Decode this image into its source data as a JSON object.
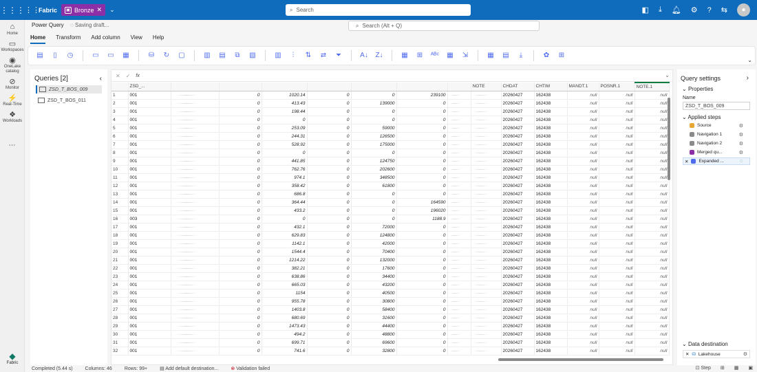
{
  "topbar": {
    "app_name": "Fabric",
    "workspace": "Bronze",
    "search_placeholder": "Search"
  },
  "rail": [
    {
      "label": "Home",
      "icon": "home-icon"
    },
    {
      "label": "Workspaces",
      "icon": "workspaces-icon"
    },
    {
      "label": "OneLake catalog",
      "icon": "onelake-icon"
    },
    {
      "label": "Monitor",
      "icon": "monitor-icon"
    },
    {
      "label": "Real-Time",
      "icon": "realtime-icon"
    },
    {
      "label": "Workloads",
      "icon": "workloads-icon"
    }
  ],
  "rail_fabric_label": "Fabric",
  "editor": {
    "title": "Power Query",
    "saving": "Saving draft...",
    "command_search": "Search (Alt + Q)"
  },
  "tabs": [
    "Home",
    "Transform",
    "Add column",
    "View",
    "Help"
  ],
  "queries": {
    "heading": "Queries [2]",
    "items": [
      "ZSD_T_BOS_009",
      "ZSD_T_BOS_011"
    ]
  },
  "grid": {
    "columns": [
      "",
      "ZSD_...",
      "",
      "",
      "",
      "",
      "",
      "",
      "",
      "NOTE",
      "CHDAT",
      "CHTIM",
      "MANDT.1",
      "POSNR.1",
      "NOTE.1"
    ],
    "rows": [
      [
        "1",
        "001",
        "",
        "0",
        "1020.14",
        "0",
        "0",
        "239100",
        "",
        "",
        "20260427",
        "162438",
        "null",
        "null",
        "null"
      ],
      [
        "2",
        "001",
        "",
        "0",
        "413.43",
        "0",
        "139000",
        "0",
        "",
        "",
        "20260427",
        "162438",
        "null",
        "null",
        "null"
      ],
      [
        "3",
        "001",
        "",
        "0",
        "198.44",
        "0",
        "0",
        "0",
        "",
        "",
        "20260427",
        "162438",
        "null",
        "null",
        "null"
      ],
      [
        "4",
        "001",
        "",
        "0",
        "0",
        "0",
        "0",
        "0",
        "",
        "",
        "20260427",
        "162438",
        "null",
        "null",
        "null"
      ],
      [
        "5",
        "001",
        "",
        "0",
        "253.09",
        "0",
        "59000",
        "0",
        "",
        "",
        "20260427",
        "162438",
        "null",
        "null",
        "null"
      ],
      [
        "6",
        "001",
        "",
        "0",
        "244.31",
        "0",
        "126500",
        "0",
        "",
        "",
        "20260427",
        "162438",
        "null",
        "null",
        "null"
      ],
      [
        "7",
        "001",
        "",
        "0",
        "528.92",
        "0",
        "175000",
        "0",
        "",
        "",
        "20260427",
        "162438",
        "null",
        "null",
        "null"
      ],
      [
        "8",
        "001",
        "",
        "0",
        "0",
        "0",
        "0",
        "0",
        "",
        "",
        "20260427",
        "162438",
        "null",
        "null",
        "null"
      ],
      [
        "9",
        "001",
        "",
        "0",
        "441.85",
        "0",
        "124750",
        "0",
        "",
        "",
        "20260427",
        "162438",
        "null",
        "null",
        "null"
      ],
      [
        "10",
        "001",
        "",
        "0",
        "762.76",
        "0",
        "202600",
        "0",
        "",
        "",
        "20260427",
        "162438",
        "null",
        "null",
        "null"
      ],
      [
        "11",
        "001",
        "",
        "0",
        "974.1",
        "0",
        "348500",
        "0",
        "",
        "",
        "20260427",
        "162438",
        "null",
        "null",
        "null"
      ],
      [
        "12",
        "001",
        "",
        "0",
        "358.42",
        "0",
        "61800",
        "0",
        "",
        "",
        "20260427",
        "162438",
        "null",
        "null",
        "null"
      ],
      [
        "13",
        "001",
        "",
        "0",
        "686.8",
        "0",
        "0",
        "0",
        "",
        "",
        "20260427",
        "162438",
        "null",
        "null",
        "null"
      ],
      [
        "14",
        "001",
        "",
        "0",
        "364.44",
        "0",
        "0",
        "164590",
        "",
        "",
        "20260427",
        "162438",
        "null",
        "null",
        "null"
      ],
      [
        "15",
        "001",
        "",
        "0",
        "433.2",
        "0",
        "0",
        "196020",
        "",
        "",
        "20260427",
        "162438",
        "null",
        "null",
        "null"
      ],
      [
        "16",
        "003",
        "",
        "0",
        "0",
        "0",
        "0",
        "1188.9",
        "",
        "",
        "20260427",
        "162438",
        "null",
        "null",
        "null"
      ],
      [
        "17",
        "001",
        "",
        "0",
        "432.1",
        "0",
        "72000",
        "0",
        "",
        "",
        "20260427",
        "162438",
        "null",
        "null",
        "null"
      ],
      [
        "18",
        "001",
        "",
        "0",
        "629.83",
        "0",
        "124800",
        "0",
        "",
        "",
        "20260427",
        "162438",
        "null",
        "null",
        "null"
      ],
      [
        "19",
        "001",
        "",
        "0",
        "1142.1",
        "0",
        "42000",
        "0",
        "",
        "",
        "20260427",
        "162438",
        "null",
        "null",
        "null"
      ],
      [
        "20",
        "001",
        "",
        "0",
        "1544.4",
        "0",
        "70400",
        "0",
        "",
        "",
        "20260427",
        "162438",
        "null",
        "null",
        "null"
      ],
      [
        "21",
        "001",
        "",
        "0",
        "1214.22",
        "0",
        "132000",
        "0",
        "",
        "",
        "20260427",
        "162438",
        "null",
        "null",
        "null"
      ],
      [
        "22",
        "001",
        "",
        "0",
        "382.21",
        "0",
        "17600",
        "0",
        "",
        "",
        "20260427",
        "162438",
        "null",
        "null",
        "null"
      ],
      [
        "23",
        "001",
        "",
        "0",
        "638.86",
        "0",
        "34400",
        "0",
        "",
        "",
        "20260427",
        "162438",
        "null",
        "null",
        "null"
      ],
      [
        "24",
        "001",
        "",
        "0",
        "665.03",
        "0",
        "43200",
        "0",
        "",
        "",
        "20260427",
        "162438",
        "null",
        "null",
        "null"
      ],
      [
        "25",
        "001",
        "",
        "0",
        "1154",
        "0",
        "40500",
        "0",
        "",
        "",
        "20260427",
        "162438",
        "null",
        "null",
        "null"
      ],
      [
        "26",
        "001",
        "",
        "0",
        "955.78",
        "0",
        "30800",
        "0",
        "",
        "",
        "20260427",
        "162438",
        "null",
        "null",
        "null"
      ],
      [
        "27",
        "001",
        "",
        "0",
        "1403.8",
        "0",
        "58400",
        "0",
        "",
        "",
        "20260427",
        "162438",
        "null",
        "null",
        "null"
      ],
      [
        "28",
        "001",
        "",
        "0",
        "680.69",
        "0",
        "31600",
        "0",
        "",
        "",
        "20260427",
        "162438",
        "null",
        "null",
        "null"
      ],
      [
        "29",
        "001",
        "",
        "0",
        "1473.43",
        "0",
        "44400",
        "0",
        "",
        "",
        "20260427",
        "162438",
        "null",
        "null",
        "null"
      ],
      [
        "30",
        "001",
        "",
        "0",
        "494.2",
        "0",
        "48800",
        "0",
        "",
        "",
        "20260427",
        "162438",
        "null",
        "null",
        "null"
      ],
      [
        "31",
        "001",
        "",
        "0",
        "699.71",
        "0",
        "69600",
        "0",
        "",
        "",
        "20260427",
        "162438",
        "null",
        "null",
        "null"
      ],
      [
        "32",
        "001",
        "",
        "0",
        "741.6",
        "0",
        "32800",
        "0",
        "",
        "",
        "20260427",
        "162438",
        "null",
        "null",
        "null"
      ]
    ]
  },
  "settings": {
    "title": "Query settings",
    "properties": "Properties",
    "name_label": "Name",
    "name_value": "ZSD_T_BOS_009",
    "applied_steps": "Applied steps",
    "steps": [
      {
        "label": "Source",
        "color": "#e8a735"
      },
      {
        "label": "Navigation 1",
        "color": "#8a8a8a"
      },
      {
        "label": "Navigation 2",
        "color": "#8a8a8a"
      },
      {
        "label": "Merged qu...",
        "color": "#8c2fa6"
      },
      {
        "label": "Expanded ...",
        "color": "#4f6bed"
      }
    ],
    "data_destination": "Data destination",
    "destination": "Lakehouse"
  },
  "status": {
    "completed": "Completed (5.44 s)",
    "columns": "Columns: 46",
    "rows": "Rows: 99+",
    "add_dest": "Add default destination...",
    "validation": "Validation failed",
    "step": "Step"
  }
}
